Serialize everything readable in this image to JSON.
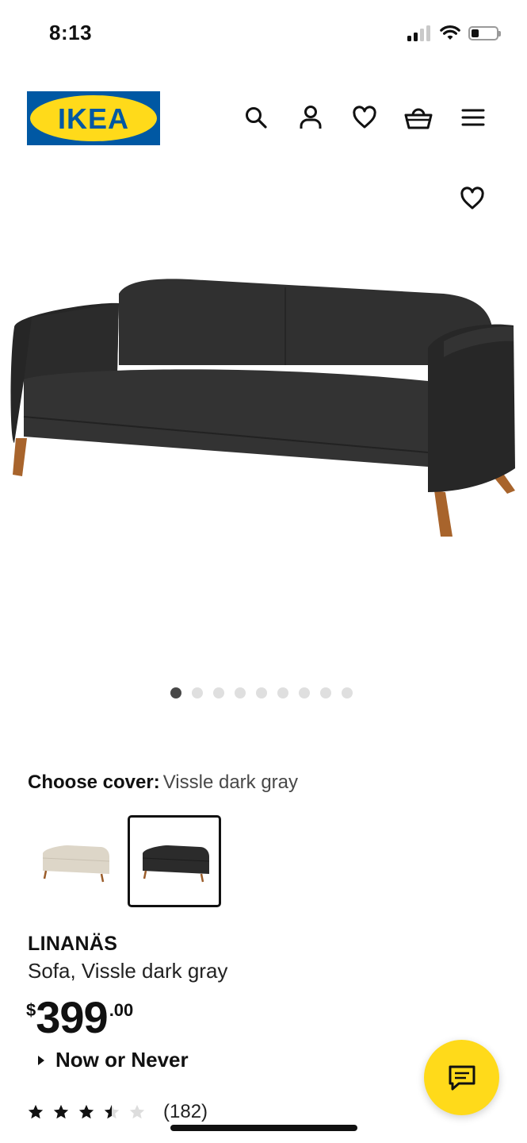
{
  "status_bar": {
    "time": "8:13"
  },
  "header": {
    "brand": "IKEA",
    "icons": [
      "search-icon",
      "user-icon",
      "heart-icon",
      "basket-icon",
      "menu-icon"
    ]
  },
  "product": {
    "image_icon": "heart-icon",
    "gallery_count": 9,
    "gallery_active_index": 0,
    "cover_label": "Choose cover:",
    "cover_value": "Vissle dark gray",
    "swatches": [
      {
        "color_name": "beige",
        "color": "#ddd6c8",
        "selected": false
      },
      {
        "color_name": "dark-gray",
        "color": "#2b2b2b",
        "selected": true
      }
    ],
    "name": "LINANÄS",
    "description": "Sofa, Vissle dark gray",
    "price": {
      "currency": "$",
      "integer": "399",
      "decimal": ".00"
    },
    "promo": "Now or Never",
    "rating": {
      "stars": 3.5,
      "max": 5,
      "count": "(182)"
    }
  },
  "colors": {
    "ikea_blue": "#0058a3",
    "ikea_yellow": "#ffda1a"
  }
}
